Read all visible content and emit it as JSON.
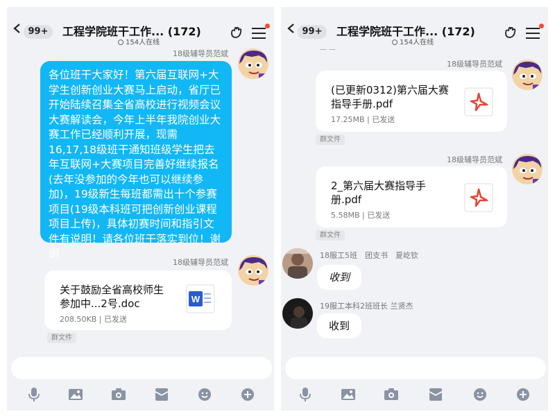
{
  "header": {
    "badge": "99+",
    "title": "工程学院班干工作... (172)",
    "online": "154人在线"
  },
  "left": {
    "msg1": {
      "sender": "18级辅导员范斌",
      "text": "各位班干大家好！第六届互联网+大学生创新创业大赛马上启动，省厅已开始陆续召集全省高校进行视频会议大赛解读会，今年上半年我院创业大赛工作已经顺利开展，现需16,17,18级班干通知班级学生把去年互联网+大赛项目完善好继续报名(去年没参加的今年也可以继续参加)，19级新生每班都需出十个参赛项目(19级本科班可把创新创业课程项目上传)，具体初赛时间和指引文件有说明！请各位班干落实到位！谢谢"
    },
    "msg2": {
      "sender": "18级辅导员范斌",
      "file_name": "关于鼓励全省高校师生参加中...2号.doc",
      "file_meta": "208.50KB | 已发送",
      "file_icon": "word-doc-icon",
      "tag": "群文件"
    }
  },
  "right": {
    "msg1": {
      "file_name": "(已更新0312)第六届大赛指导手册.pdf",
      "file_meta": "17.25MB | 已发送",
      "file_icon": "pdf-icon",
      "sender": "18级辅导员范斌",
      "tag": "群文件"
    },
    "msg2": {
      "sender": "18级辅导员范斌",
      "file_name": "2_第六届大赛指导手册.pdf",
      "file_meta": "5.58MB | 已发送",
      "file_icon": "pdf-icon",
      "tag": "群文件"
    },
    "msg3": {
      "sender": "18服工5班　团支书　夏屹钦",
      "text": "收到"
    },
    "msg4": {
      "sender": "19服工本科2班班长 兰贤杰",
      "text": "收到"
    }
  },
  "toolbar": [
    "microphone-icon",
    "image-icon",
    "camera-icon",
    "red-packet-icon",
    "emoji-icon",
    "plus-icon"
  ],
  "colors": {
    "bubble": "#12b7f5",
    "bg": "#f1f2f6",
    "pdf": "#e94236",
    "word": "#2b5ccd"
  }
}
